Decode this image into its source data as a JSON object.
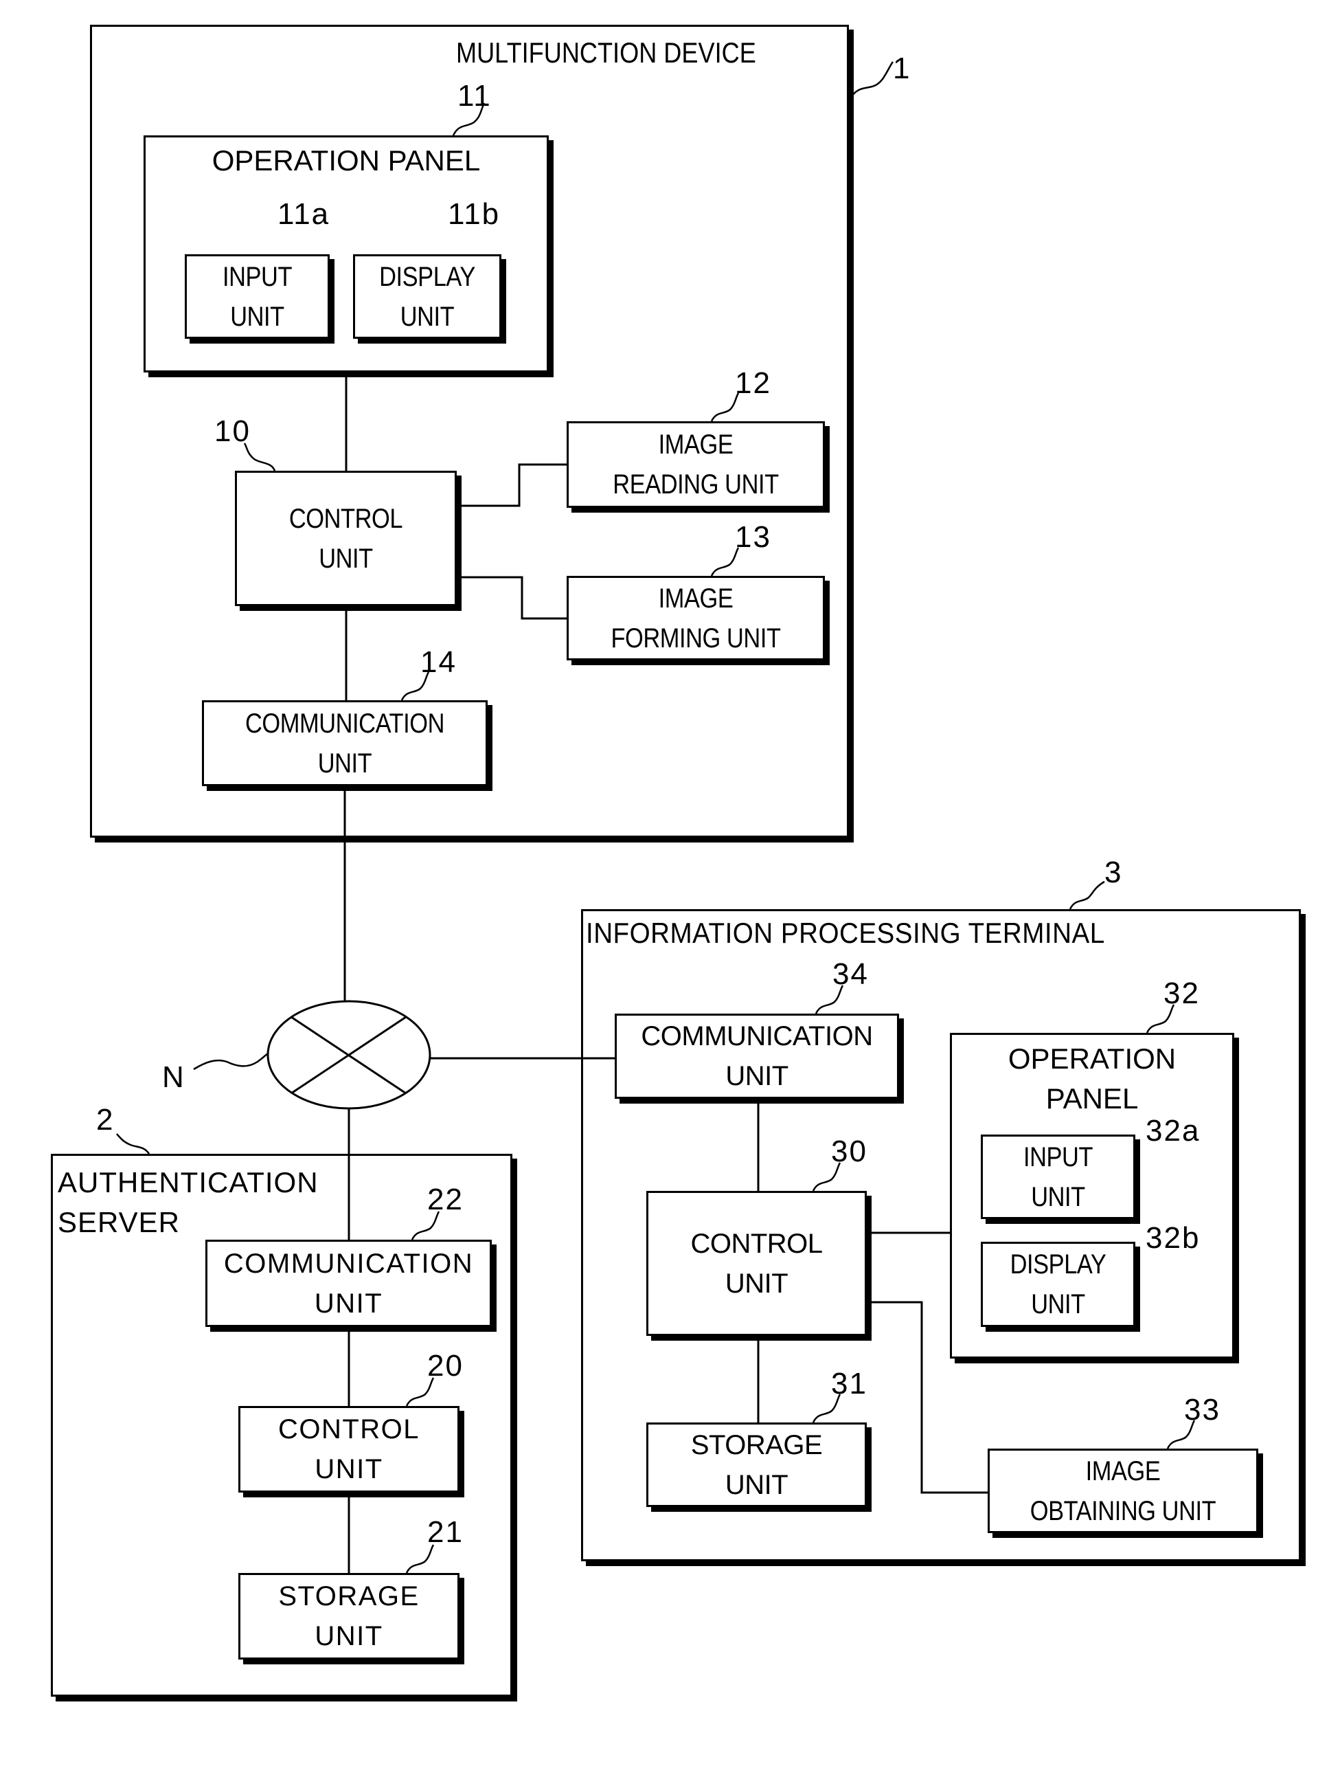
{
  "figure": {
    "type": "system block diagram",
    "network": {
      "label": "N"
    },
    "multifunction_device": {
      "ref": "1",
      "title": "MULTIFUNCTION DEVICE",
      "operation_panel": {
        "ref": "11",
        "title": "OPERATION PANEL",
        "input_unit": {
          "ref": "11a",
          "label": "INPUT\nUNIT"
        },
        "display_unit": {
          "ref": "11b",
          "label": "DISPLAY\nUNIT"
        }
      },
      "control_unit": {
        "ref": "10",
        "label": "CONTROL\nUNIT"
      },
      "image_reading_unit": {
        "ref": "12",
        "label": "IMAGE\nREADING UNIT"
      },
      "image_forming_unit": {
        "ref": "13",
        "label": "IMAGE\nFORMING UNIT"
      },
      "communication_unit": {
        "ref": "14",
        "label": "COMMUNICATION\nUNIT"
      }
    },
    "authentication_server": {
      "ref": "2",
      "title": "AUTHENTICATION\nSERVER",
      "communication_unit": {
        "ref": "22",
        "label": "COMMUNICATION\nUNIT"
      },
      "control_unit": {
        "ref": "20",
        "label": "CONTROL\nUNIT"
      },
      "storage_unit": {
        "ref": "21",
        "label": "STORAGE\nUNIT"
      }
    },
    "information_processing_terminal": {
      "ref": "3",
      "title": "INFORMATION PROCESSING TERMINAL",
      "communication_unit": {
        "ref": "34",
        "label": "COMMUNICATION\nUNIT"
      },
      "operation_panel": {
        "ref": "32",
        "title": "OPERATION\nPANEL",
        "input_unit": {
          "ref": "32a",
          "label": "INPUT\nUNIT"
        },
        "display_unit": {
          "ref": "32b",
          "label": "DISPLAY\nUNIT"
        }
      },
      "control_unit": {
        "ref": "30",
        "label": "CONTROL\nUNIT"
      },
      "storage_unit": {
        "ref": "31",
        "label": "STORAGE\nUNIT"
      },
      "image_obtaining_unit": {
        "ref": "33",
        "label": "IMAGE\nOBTAINING UNIT"
      }
    },
    "colors": {
      "line": "#000000",
      "background": "#ffffff"
    }
  }
}
